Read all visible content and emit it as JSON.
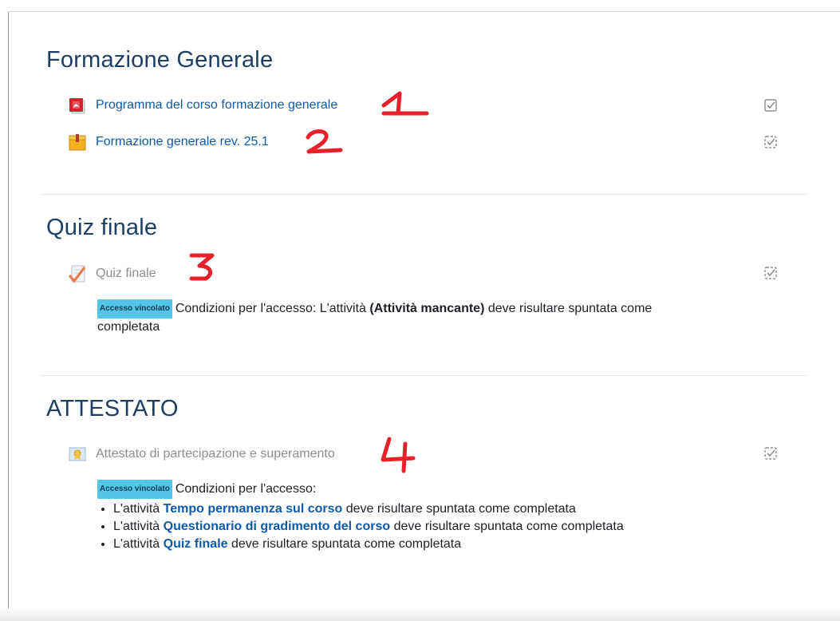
{
  "sections": [
    {
      "title": "Formazione Generale",
      "activities": [
        {
          "label": "Programma del corso formazione generale",
          "icon": "pdf-icon",
          "completion": "manual-completion-icon"
        },
        {
          "label": "Formazione generale rev. 25.1",
          "icon": "scorm-package-icon",
          "completion": "auto-completion-icon"
        }
      ]
    },
    {
      "title": "Quiz finale",
      "activities": [
        {
          "label": "Quiz finale",
          "icon": "quiz-icon",
          "completion": "auto-completion-icon"
        }
      ],
      "restriction": {
        "badge": "Accesso vincolato",
        "prefix": "Condizioni per l'accesso: L'attività ",
        "bold": "(Attività mancante)",
        "suffix": " deve risultare spuntata come",
        "line2": "completata"
      }
    },
    {
      "title": "ATTESTATO",
      "activities": [
        {
          "label": "Attestato di partecipazione e superamento",
          "icon": "certificate-icon",
          "completion": "auto-completion-icon"
        }
      ],
      "restriction": {
        "badge": "Accesso vincolato",
        "intro": "Condizioni per l'accesso:",
        "conditions": [
          {
            "prefix": "L'attività ",
            "name": "Tempo permanenza sul corso",
            "suffix": " deve risultare spuntata come completata"
          },
          {
            "prefix": "L'attività ",
            "name": "Questionario di gradimento del corso",
            "suffix": " deve risultare spuntata come completata"
          },
          {
            "prefix": "L'attività ",
            "name": "Quiz finale",
            "suffix": " deve risultare spuntata come completata"
          }
        ]
      }
    }
  ],
  "colors": {
    "section_title": "#1f3e66",
    "link": "#0f5aa8",
    "dimmed_link": "#8a8e92",
    "badge_bg": "#53c6e6",
    "annotation": "#e8202a"
  }
}
